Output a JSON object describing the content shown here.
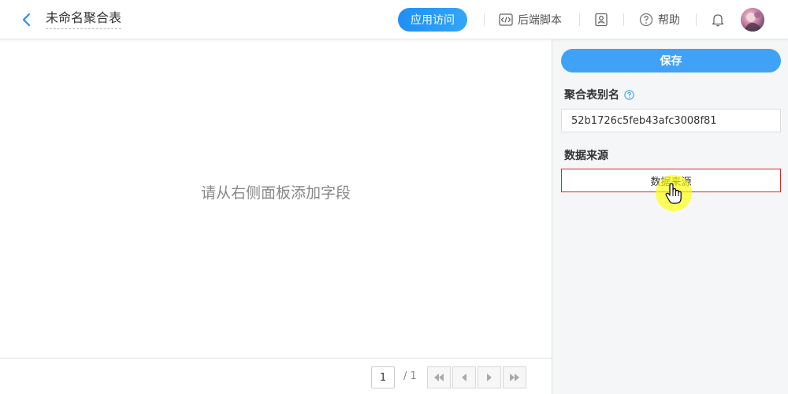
{
  "header": {
    "title": "未命名聚合表",
    "visit_label": "应用访问",
    "script_label": "后端脚本",
    "help_label": "帮助"
  },
  "canvas": {
    "empty_tip": "请从右侧面板添加字段"
  },
  "pager": {
    "current_page": "1",
    "total": "/ 1"
  },
  "panel": {
    "save_label": "保存",
    "alias_label": "聚合表别名",
    "alias_value": "52b1726c5feb43afc3008f81",
    "source_label": "数据来源",
    "source_button": "数据来源"
  },
  "colors": {
    "accent": "#3fa2f7",
    "source_border": "#c9302c"
  }
}
